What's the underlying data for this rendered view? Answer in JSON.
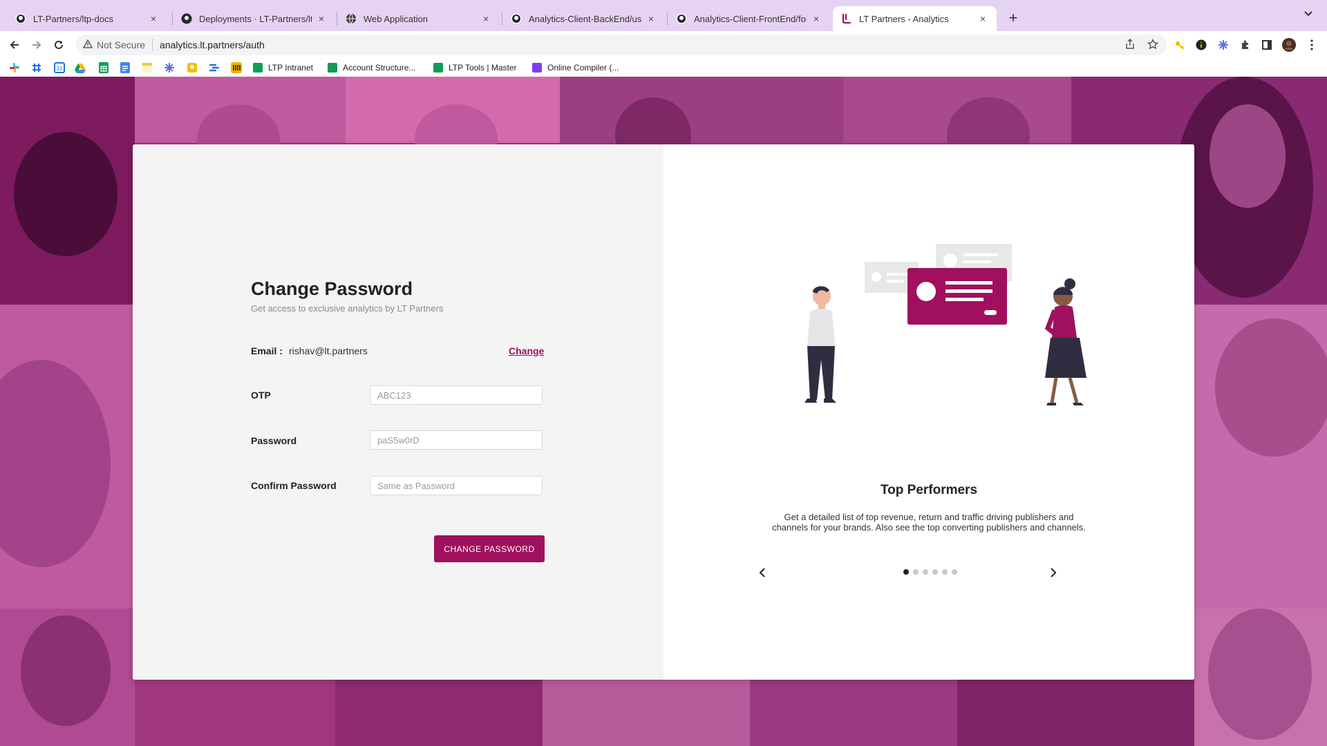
{
  "browser": {
    "tabs": [
      {
        "title": "LT-Partners/ltp-docs",
        "icon": "github-icon"
      },
      {
        "title": "Deployments · LT-Partners/ltp-docs",
        "icon": "github-icon"
      },
      {
        "title": "Web Application",
        "icon": "globe-icon"
      },
      {
        "title": "Analytics-Client-BackEnd/user",
        "icon": "github-icon"
      },
      {
        "title": "Analytics-Client-FrontEnd/forgot",
        "icon": "github-icon"
      },
      {
        "title": "LT Partners - Analytics",
        "icon": "ltp-logo-icon",
        "active": true
      }
    ],
    "tab_close_glyph": "×",
    "new_tab_glyph": "+",
    "security_label": "Not Secure",
    "url": "analytics.lt.partners/auth",
    "bookmarks": [
      {
        "label": "LTP Intranet",
        "color": "#0f9d58"
      },
      {
        "label": "Account Structure...",
        "color": "#0f9d58"
      },
      {
        "label": "LTP Tools | Master",
        "color": "#0f9d58"
      },
      {
        "label": "Online Compiler (...",
        "color": "#7b3ff2"
      }
    ]
  },
  "form": {
    "title": "Change Password",
    "subtitle": "Get access to exclusive analytics by LT Partners",
    "email_label": "Email :",
    "email_value": "rishav@lt.partners",
    "change_link": "Change",
    "otp_label": "OTP",
    "otp_placeholder": "ABC123",
    "password_label": "Password",
    "password_placeholder": "paS5w0rD",
    "confirm_label": "Confirm Password",
    "confirm_placeholder": "Same as Password",
    "submit_label": "CHANGE PASSWORD"
  },
  "carousel": {
    "title": "Top Performers",
    "description": "Get a detailed list of top revenue, return and traffic driving publishers and channels for your brands. Also see the top converting publishers and channels.",
    "slide_count": 6,
    "active_index": 0,
    "prev_glyph": "‹",
    "next_glyph": "›"
  },
  "colors": {
    "brand": "#a0105e",
    "background_overlay": "#a52f85",
    "tab_strip": "#e6d2f2"
  }
}
